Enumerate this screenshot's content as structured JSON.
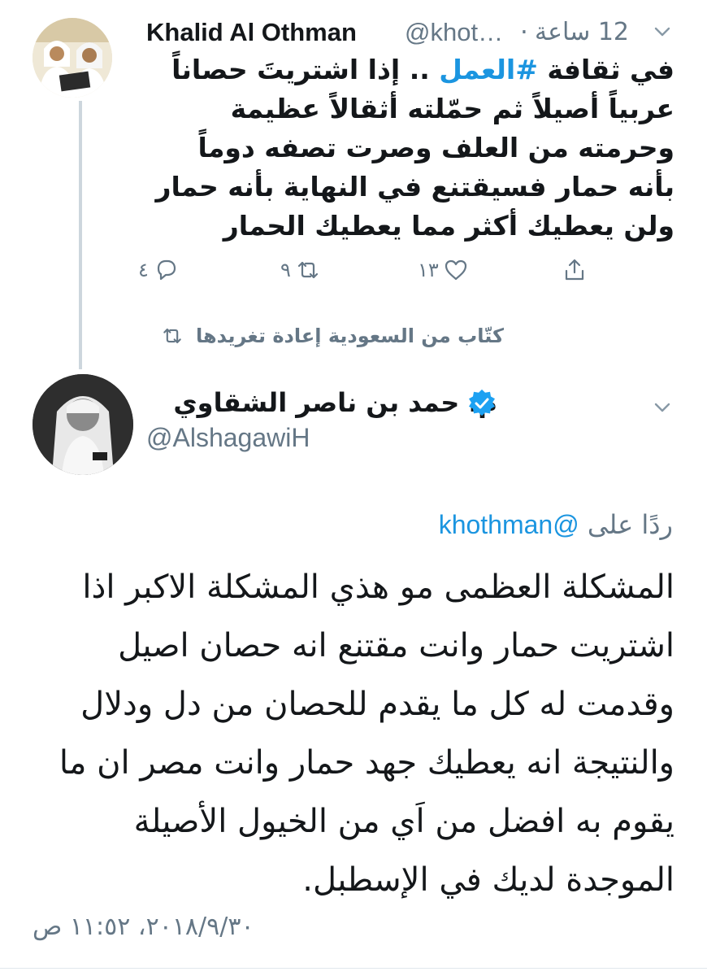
{
  "tweet1": {
    "display_name": "Khalid Al Othman",
    "handle": "@khot…",
    "separator": "·",
    "time": "12 ساعة",
    "text_prefix": "في ثقافة ",
    "hashtag": "#العمل",
    "text_rest": " .. إذا اشتريتَ حصاناً عربياً أصيلاً ثم حمّلته أثقالاً عظيمة وحرمته من العلف وصرت تصفه دوماً بأنه حمار فسيقتنع في النهاية بأنه حمار ولن يعطيك أكثر مما يعطيك الحمار",
    "reply_count": "٤",
    "retweet_count": "٩",
    "like_count": "١٣"
  },
  "retweet_note": "كتّاب من السعودية إعادة تغريدها",
  "tweet2": {
    "display_name": "م. حمد بن ناصر الشقاوي",
    "handle": "@AlshagawiH",
    "replying_prefix": "ردًا على",
    "replying_to": "@khothman",
    "text": "المشكلة العظمى مو هذي المشكلة الاكبر اذا اشتريت حمار وانت مقتنع انه حصان اصيل وقدمت له كل ما يقدم للحصان من دل ودلال والنتيجة انه يعطيك جهد حمار وانت مصر ان ما يقوم به افضل من اَي من الخيول الأصيلة الموجدة لديك في الإسطبل.",
    "timestamp": "٢٠١٨/٩/٣٠، ١١:٥٢ ص"
  },
  "colors": {
    "accent": "#1b95e0",
    "secondary_text": "#657786",
    "primary_text": "#14171a",
    "thread_line": "#cdd6dd"
  },
  "icons": [
    "chevron-down-icon",
    "reply-icon",
    "retweet-icon",
    "like-icon",
    "share-icon",
    "verified-badge-icon"
  ]
}
